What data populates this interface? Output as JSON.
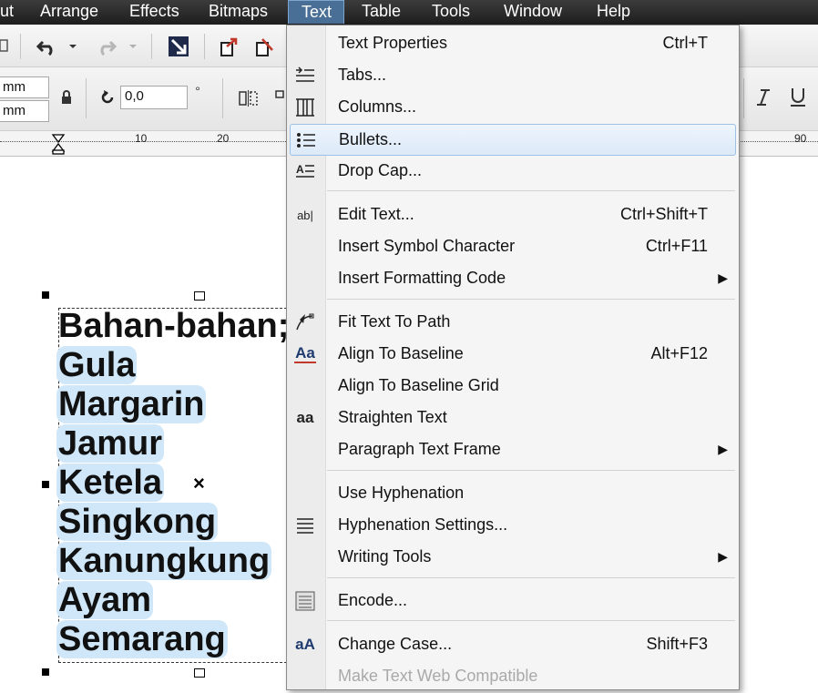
{
  "menubar": {
    "items": [
      {
        "label": "ut"
      },
      {
        "label": "Arrange"
      },
      {
        "label": "Effects"
      },
      {
        "label": "Bitmaps"
      },
      {
        "label": "Text"
      },
      {
        "label": "Table"
      },
      {
        "label": "Tools"
      },
      {
        "label": "Window"
      },
      {
        "label": "Help"
      }
    ]
  },
  "property_bar": {
    "size_field_1": "mm",
    "size_field_2": "mm",
    "rotation_value": "0,0",
    "degree_symbol": "°"
  },
  "ruler": {
    "labels": [
      "10",
      "20",
      "90"
    ]
  },
  "canvas": {
    "lines": [
      "Bahan-bahan;",
      "Gula",
      "Margarin",
      "Jamur",
      "Ketela",
      "Singkong",
      "Kanungkung",
      "Ayam",
      "Semarang"
    ],
    "center_mark": "×"
  },
  "text_menu": {
    "items": [
      {
        "label": "Text Properties",
        "shortcut": "Ctrl+T"
      },
      {
        "label": "Tabs...",
        "shortcut": ""
      },
      {
        "label": "Columns...",
        "shortcut": ""
      },
      {
        "label": "Bullets...",
        "shortcut": ""
      },
      {
        "label": "Drop Cap...",
        "shortcut": ""
      },
      {
        "label": "Edit Text...",
        "shortcut": "Ctrl+Shift+T"
      },
      {
        "label": "Insert Symbol Character",
        "shortcut": "Ctrl+F11"
      },
      {
        "label": "Insert Formatting Code",
        "shortcut": ""
      },
      {
        "label": "Fit Text To Path",
        "shortcut": ""
      },
      {
        "label": "Align To Baseline",
        "shortcut": "Alt+F12"
      },
      {
        "label": "Align To Baseline Grid",
        "shortcut": ""
      },
      {
        "label": "Straighten Text",
        "shortcut": ""
      },
      {
        "label": "Paragraph Text Frame",
        "shortcut": ""
      },
      {
        "label": "Use Hyphenation",
        "shortcut": ""
      },
      {
        "label": "Hyphenation Settings...",
        "shortcut": ""
      },
      {
        "label": "Writing Tools",
        "shortcut": ""
      },
      {
        "label": "Encode...",
        "shortcut": ""
      },
      {
        "label": "Change Case...",
        "shortcut": "Shift+F3"
      },
      {
        "label": "Make Text Web Compatible",
        "shortcut": ""
      }
    ],
    "icons": {
      "tabs": "tabs-icon",
      "columns": "columns-icon",
      "bullets": "bullets-icon",
      "drop_cap": "drop-cap-icon",
      "edit_text": "edit-text-icon",
      "fit_text_to_path": "fit-text-to-path-icon",
      "align_to_baseline": "align-baseline-icon",
      "straighten_text": "straighten-text-icon",
      "hyphenation_settings": "hyphenation-icon",
      "encode": "encode-icon",
      "change_case": "change-case-icon"
    },
    "ico_text": {
      "edit": "ab|",
      "align": "Aa",
      "straighten": "aa",
      "change_case": "aA"
    },
    "highlight_color": "#dce9f8",
    "disabled_color": "#a9a9a9"
  },
  "colors": {
    "menubar_bg": "#2a2a2a",
    "text_selection": "#cfe7f8"
  }
}
